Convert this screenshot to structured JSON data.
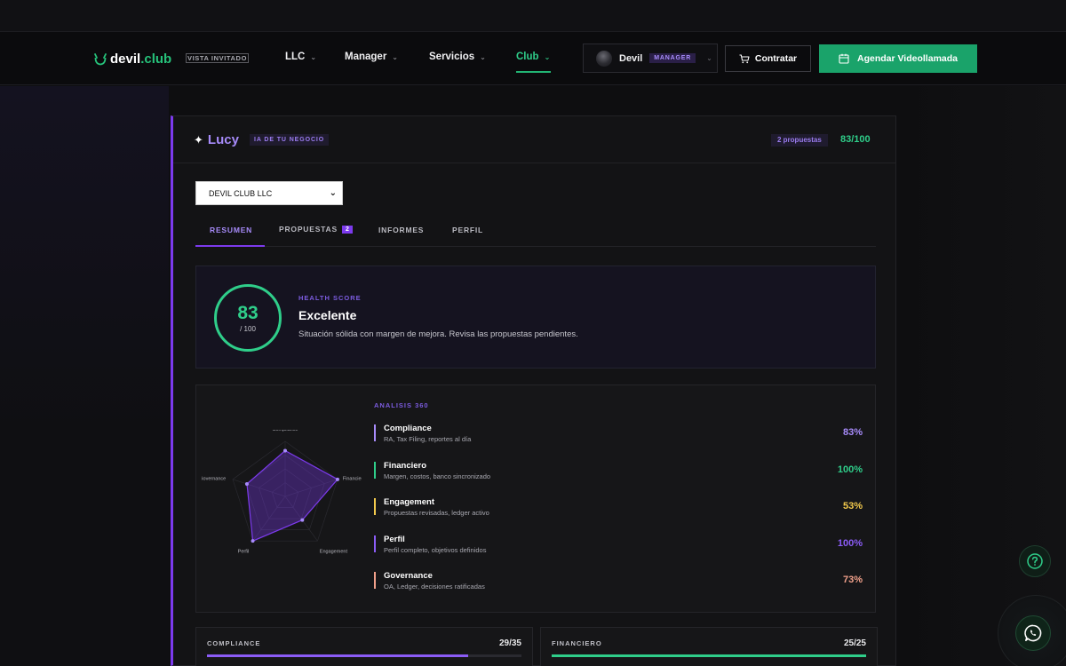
{
  "brand": {
    "name_part1": "devil",
    "name_part2": ".club",
    "guest_badge": "VISTA INVITADO"
  },
  "nav": {
    "items": [
      {
        "label": "LLC"
      },
      {
        "label": "Manager"
      },
      {
        "label": "Servicios"
      },
      {
        "label": "Club",
        "active": true
      }
    ],
    "user": {
      "name": "Devil",
      "role": "MANAGER"
    },
    "contratar_label": "Contratar",
    "video_label": "Agendar Videollamada"
  },
  "lucy": {
    "title": "Lucy",
    "badge": "IA DE TU NEGOCIO",
    "proposals_badge": "2 propuestas",
    "score": "83/100"
  },
  "company_select": {
    "value": "DEVIL CLUB LLC"
  },
  "tabs": [
    {
      "label": "RESUMEN",
      "active": true
    },
    {
      "label": "PROPUESTAS",
      "count": "2"
    },
    {
      "label": "INFORMES"
    },
    {
      "label": "PERFIL"
    }
  ],
  "health": {
    "value": "83",
    "out_of": "/ 100",
    "label": "HEALTH SCORE",
    "title": "Excelente",
    "description": "Situación sólida con margen de mejora. Revisa las propuestas pendientes."
  },
  "analysis": {
    "label": "ANALISIS 360",
    "radar_axes": [
      "Compliance",
      "Financiero",
      "Engagement",
      "Perfil",
      "Governance"
    ],
    "radar_values": [
      83,
      100,
      53,
      100,
      73
    ],
    "metrics": [
      {
        "name": "Compliance",
        "desc": "RA, Tax Filing, reportes al día",
        "value": "83%",
        "color": "#a78bfa"
      },
      {
        "name": "Financiero",
        "desc": "Margen, costos, banco sincronizado",
        "value": "100%",
        "color": "#2fce8a"
      },
      {
        "name": "Engagement",
        "desc": "Propuestas revisadas, ledger activo",
        "value": "53%",
        "color": "#f2c94c"
      },
      {
        "name": "Perfil",
        "desc": "Perfil completo, objetivos definidos",
        "value": "100%",
        "color": "#8b5cf6"
      },
      {
        "name": "Governance",
        "desc": "OA, Ledger, decisiones ratificadas",
        "value": "73%",
        "color": "#f0a08a"
      }
    ]
  },
  "subscores": [
    {
      "label": "COMPLIANCE",
      "value": "29/35",
      "fraction": 0.83,
      "color": "#8b5cf6"
    },
    {
      "label": "FINANCIERO",
      "value": "25/25",
      "fraction": 1.0,
      "color": "#2fce8a"
    }
  ]
}
